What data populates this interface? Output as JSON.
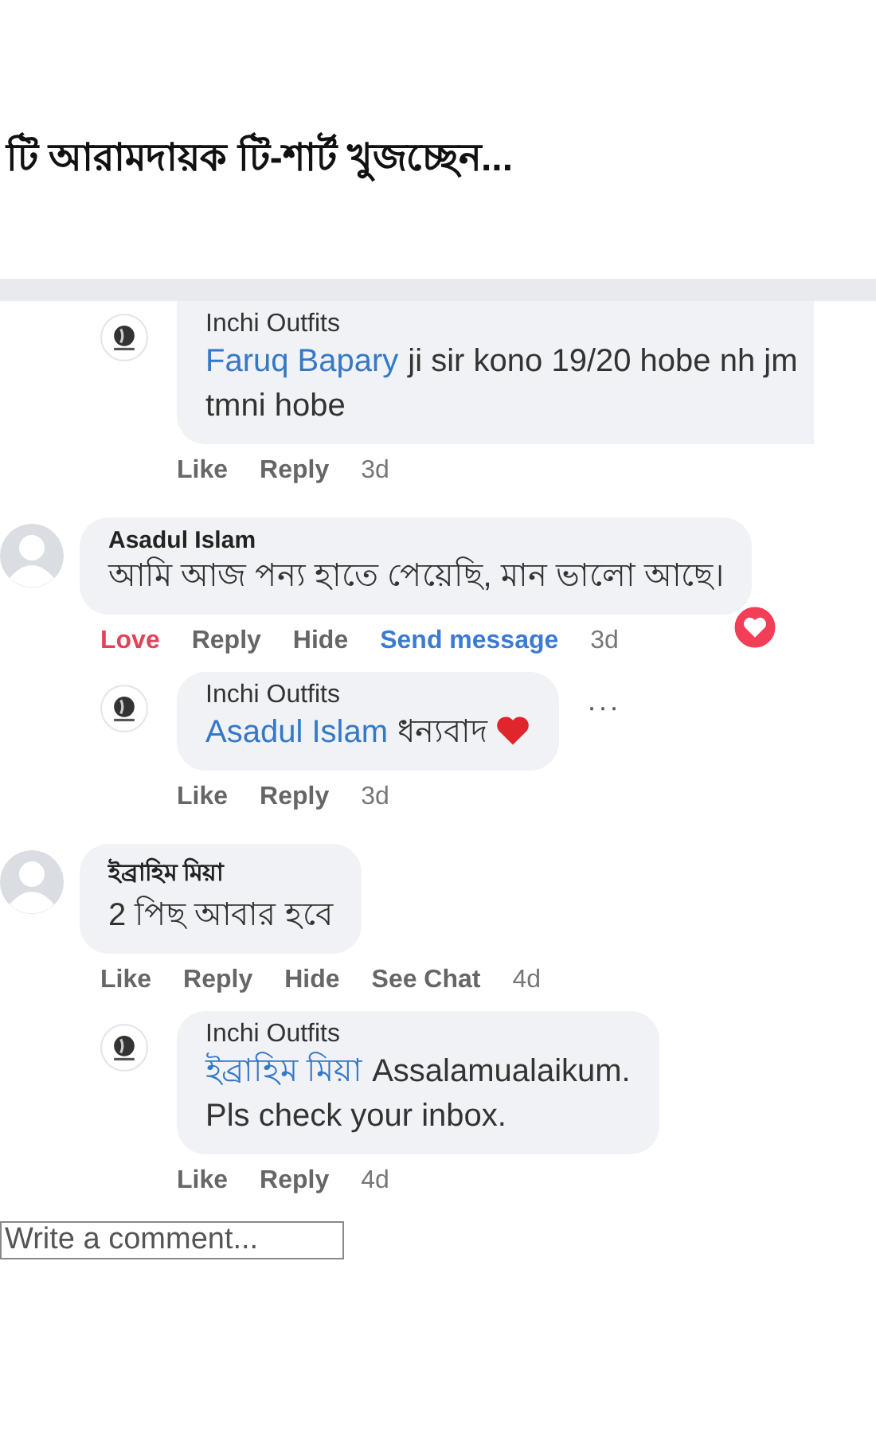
{
  "post_title": "টি আরামদায়ক টি-শার্ট খুজচ্ছেন...",
  "comments": [
    {
      "kind": "reply",
      "author": "Inchi Outfits",
      "mention": "Faruq Bapary",
      "text": "ji sir kono 19/20 hobe nh jm\ntmni hobe",
      "actions": [
        {
          "label": "Like",
          "kind": "plain"
        },
        {
          "label": "Reply",
          "kind": "plain"
        }
      ],
      "time": "3d"
    },
    {
      "kind": "comment",
      "author": "Asadul Islam",
      "text": "আমি আজ পন্য হাতে পেয়েছি, মান ভালো আছে।",
      "loved": true,
      "actions": [
        {
          "label": "Love",
          "kind": "love"
        },
        {
          "label": "Reply",
          "kind": "plain"
        },
        {
          "label": "Hide",
          "kind": "plain"
        },
        {
          "label": "Send message",
          "kind": "link"
        }
      ],
      "time": "3d"
    },
    {
      "kind": "reply",
      "author": "Inchi Outfits",
      "mention": "Asadul Islam",
      "text": "ধন্যবাদ",
      "heart_emoji": true,
      "more": "···",
      "actions": [
        {
          "label": "Like",
          "kind": "plain"
        },
        {
          "label": "Reply",
          "kind": "plain"
        }
      ],
      "time": "3d"
    },
    {
      "kind": "comment",
      "author": "ইব্রাহিম মিয়া",
      "text": "2 পিছ আবার হবে",
      "actions": [
        {
          "label": "Like",
          "kind": "plain"
        },
        {
          "label": "Reply",
          "kind": "plain"
        },
        {
          "label": "Hide",
          "kind": "plain"
        },
        {
          "label": "See Chat",
          "kind": "plain"
        }
      ],
      "time": "4d"
    },
    {
      "kind": "reply",
      "author": "Inchi Outfits",
      "mention": "ইব্রাহিম মিয়া",
      "text": "Assalamualaikum.\nPls check your inbox.",
      "actions": [
        {
          "label": "Like",
          "kind": "plain"
        },
        {
          "label": "Reply",
          "kind": "plain"
        }
      ],
      "time": "4d"
    }
  ],
  "comment_box": {
    "placeholder": "Write a comment..."
  }
}
